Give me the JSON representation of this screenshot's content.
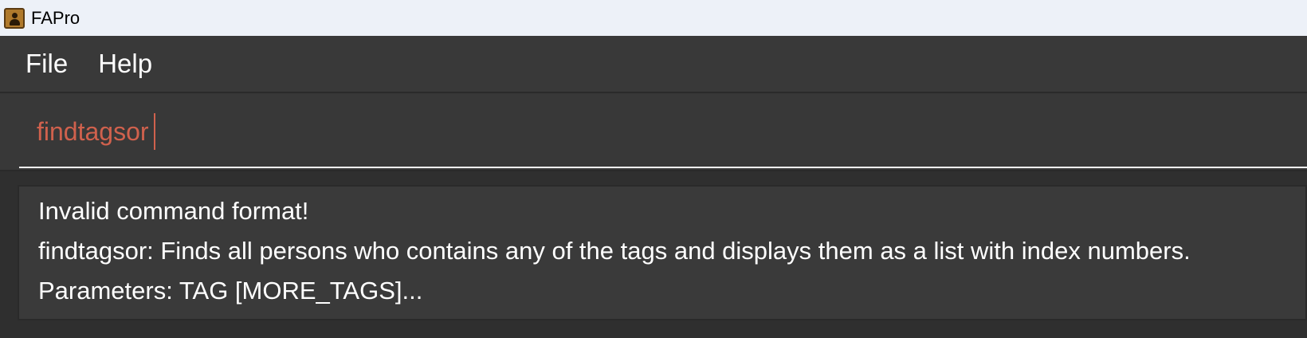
{
  "window": {
    "title": "FAPro",
    "icon": "address-book-icon"
  },
  "menu": {
    "file": "File",
    "help": "Help"
  },
  "command": {
    "value": "findtagsor"
  },
  "result": {
    "lines": [
      "Invalid command format!",
      "findtagsor: Finds all persons who contains any of the tags and displays them as a list with index numbers.",
      "Parameters: TAG [MORE_TAGS]..."
    ]
  },
  "colors": {
    "titlebar_bg": "#edf1f8",
    "menubar_bg": "#393939",
    "command_text": "#d0614d",
    "result_bg": "#3a3a3a"
  }
}
